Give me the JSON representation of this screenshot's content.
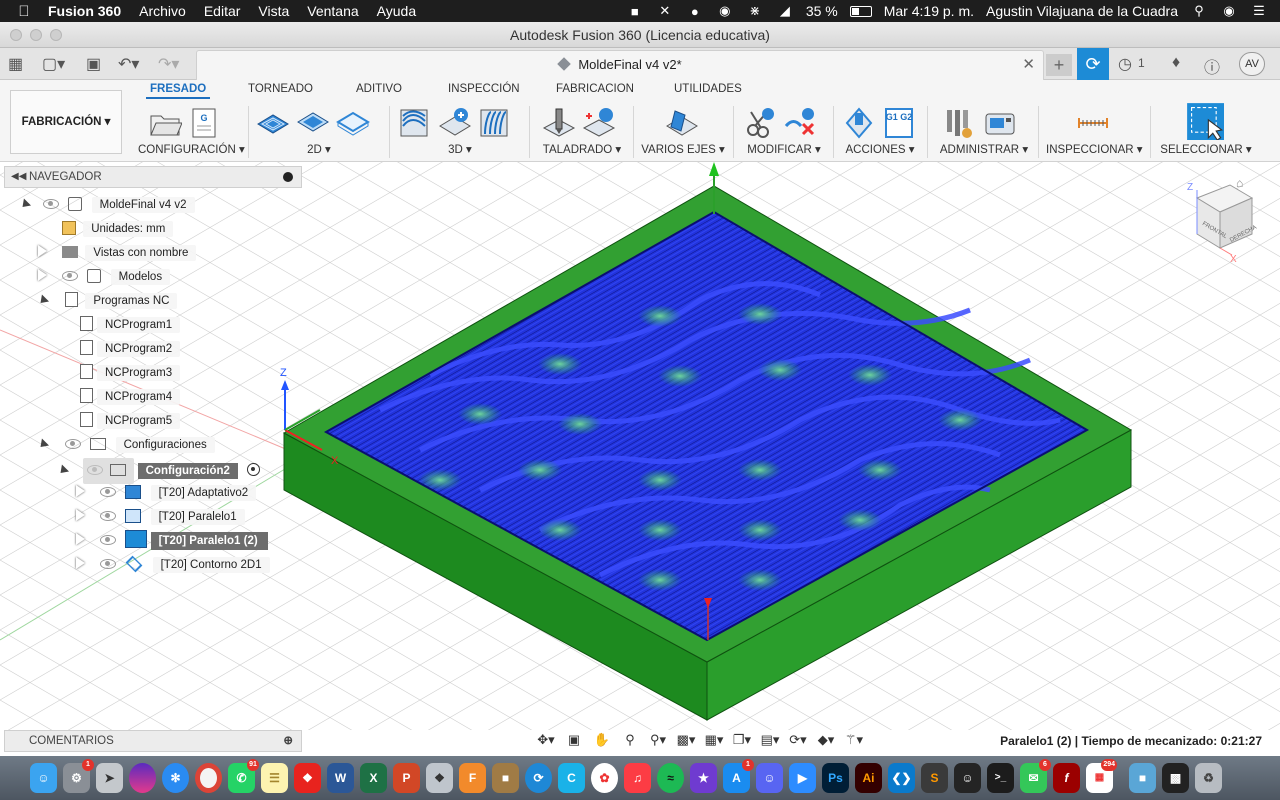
{
  "menubar": {
    "app": "Fusion 360",
    "items": [
      "Archivo",
      "Editar",
      "Vista",
      "Ventana",
      "Ayuda"
    ],
    "battery": "35 %",
    "clock": "Mar 4:19 p. m.",
    "user": "Agustin Vilajuana de la Cuadra"
  },
  "window": {
    "title": "Autodesk Fusion 360 (Licencia educativa)"
  },
  "tabbar": {
    "doc_title": "MoldeFinal v4 v2*",
    "jobs_count": "1",
    "avatar": "AV"
  },
  "ribbon": {
    "workspace": "FABRICACIÓN",
    "tabs": [
      "FRESADO",
      "TORNEADO",
      "ADITIVO",
      "INSPECCIÓN",
      "FABRICACION",
      "UTILIDADES"
    ],
    "groups": [
      "CONFIGURACIÓN",
      "2D",
      "3D",
      "TALADRADO",
      "VARIOS EJES",
      "MODIFICAR",
      "ACCIONES",
      "ADMINISTRAR",
      "INSPECCIONAR",
      "SELECCIONAR"
    ],
    "gcode_icon_text": "G1 G2"
  },
  "browser": {
    "title": "NAVEGADOR",
    "root": "MoldeFinal v4 v2",
    "units": "Unidades: mm",
    "named_views": "Vistas con nombre",
    "models": "Modelos",
    "nc_programs": "Programas NC",
    "nc_items": [
      "NCProgram1",
      "NCProgram2",
      "NCProgram3",
      "NCProgram4",
      "NCProgram5"
    ],
    "setups": "Configuraciones",
    "setup": "Configuración2",
    "operations": [
      "[T20] Adaptativo2",
      "[T20] Paralelo1",
      "[T20] Paralelo1 (2)",
      "[T20] Contorno 2D1"
    ]
  },
  "viewcube": {
    "front": "FRONTAL",
    "right": "DERECHA"
  },
  "axes": {
    "z": "Z",
    "x": "X"
  },
  "comments": "COMENTARIOS",
  "status": "Paralelo1 (2) | Tiempo de mecanizado: 0:21:27",
  "dock": {
    "apps": [
      "Finder",
      "Ajustes",
      "Launchpad",
      "Siri",
      "Safari",
      "Chrome",
      "WhatsApp",
      "Notas",
      "Acrobat",
      "Word",
      "Excel",
      "PowerPoint",
      "Preview",
      "Fusion",
      "Archive",
      "Fusion 360",
      "Camera",
      "Photos",
      "Music",
      "Spotify",
      "iMovie",
      "App Store",
      "Discord",
      "Zoom",
      "Photoshop",
      "Illustrator",
      "VS Code",
      "Sublime",
      "GitHub",
      "Terminal",
      "Messages",
      "Flash",
      "Calendar",
      "Folder",
      "Screen",
      "Trash"
    ],
    "badges": {
      "ajustes": "1",
      "whatsapp": "91",
      "appstore": "1",
      "messages": "6",
      "calendar": "294"
    },
    "ps_label": "Ps",
    "ai_label": "Ai"
  },
  "colors": {
    "accent": "#1d8bd6",
    "stock_green": "#2e8b2e",
    "toolpath_blue": "#1a2bd6",
    "selection_gray": "#6d6d6d"
  }
}
